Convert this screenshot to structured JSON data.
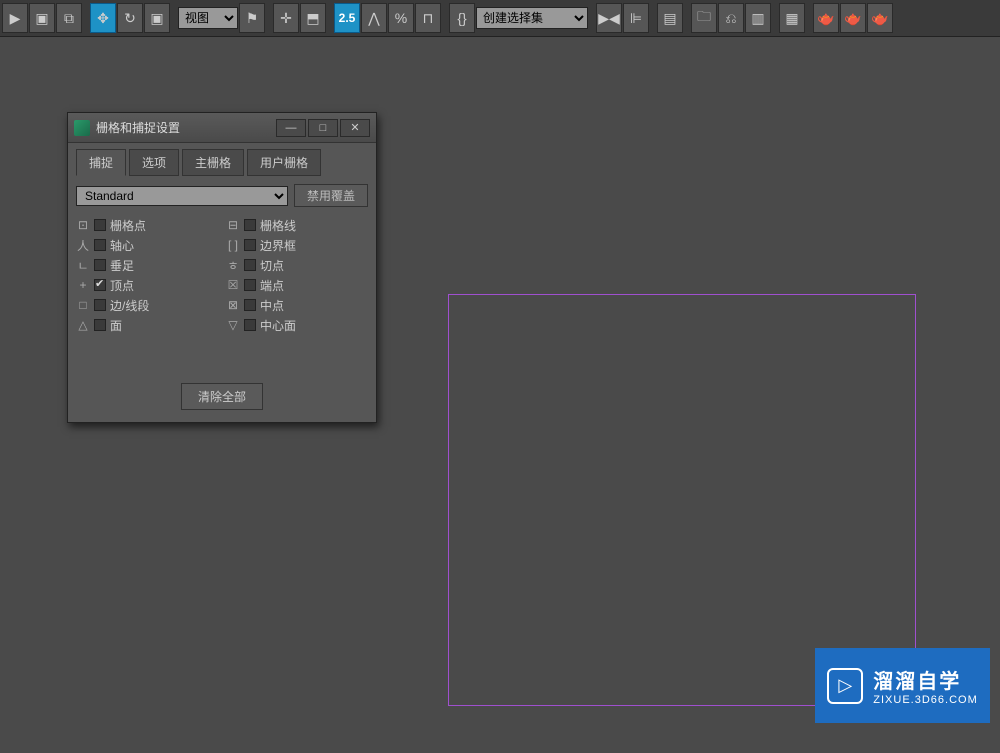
{
  "toolbar": {
    "view_select": "视图",
    "snap_label": "2.5",
    "selset_select": "创建选择集"
  },
  "dialog": {
    "title": "栅格和捕捉设置",
    "tabs": [
      "捕捉",
      "选项",
      "主栅格",
      "用户栅格"
    ],
    "combo": "Standard",
    "override_btn": "禁用覆盖",
    "clear_btn": "清除全部",
    "snaps_left": [
      {
        "glyph": "⊡",
        "label": "栅格点",
        "checked": false
      },
      {
        "glyph": "人",
        "label": "轴心",
        "checked": false
      },
      {
        "glyph": "ㄴ",
        "label": "垂足",
        "checked": false
      },
      {
        "glyph": "+",
        "label": "顶点",
        "checked": true
      },
      {
        "glyph": "□",
        "label": "边/线段",
        "checked": false
      },
      {
        "glyph": "△",
        "label": "面",
        "checked": false
      }
    ],
    "snaps_right": [
      {
        "glyph": "⊟",
        "label": "栅格线",
        "checked": false
      },
      {
        "glyph": "[ ]",
        "label": "边界框",
        "checked": false
      },
      {
        "glyph": "ㅎ",
        "label": "切点",
        "checked": false
      },
      {
        "glyph": "☒",
        "label": "端点",
        "checked": false
      },
      {
        "glyph": "⊠",
        "label": "中点",
        "checked": false
      },
      {
        "glyph": "▽",
        "label": "中心面",
        "checked": false
      }
    ]
  },
  "watermark": {
    "main": "溜溜自学",
    "sub": "ZIXUE.3D66.COM"
  }
}
